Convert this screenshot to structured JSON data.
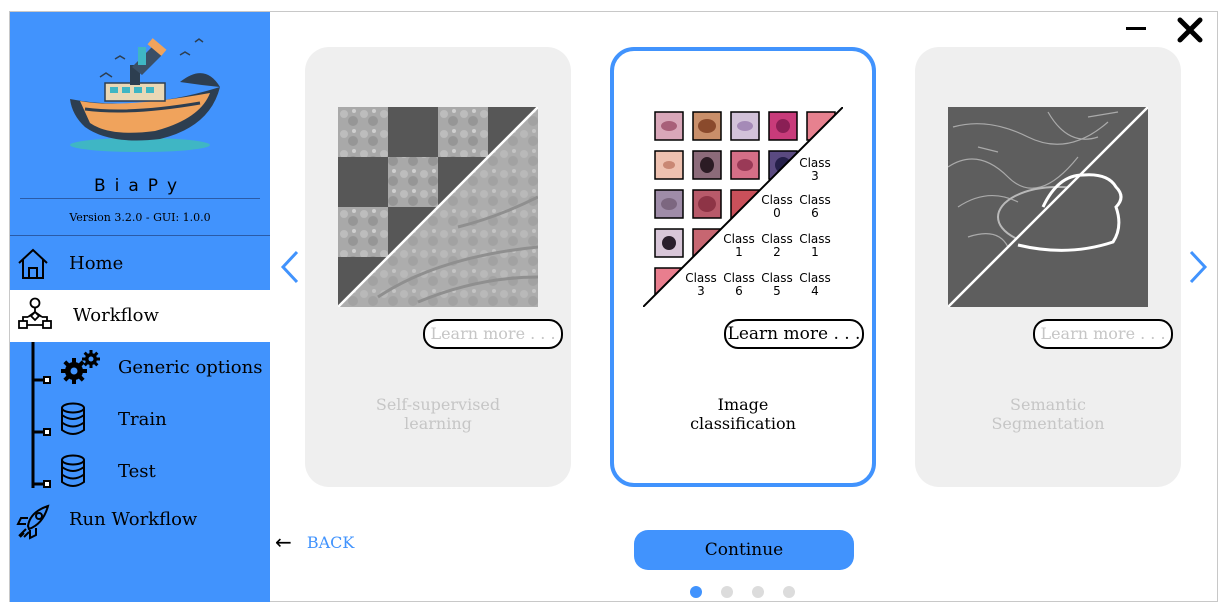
{
  "sidebar": {
    "app_name": "BiaPy",
    "version": "Version 3.2.0 - GUI: 1.0.0",
    "items": [
      {
        "label": "Home",
        "icon": "home-icon"
      },
      {
        "label": "Workflow",
        "icon": "workflow-icon",
        "selected": true
      },
      {
        "label": "Generic options",
        "icon": "gears-icon"
      },
      {
        "label": "Train",
        "icon": "database-icon"
      },
      {
        "label": "Test",
        "icon": "database-icon"
      },
      {
        "label": "Run Workflow",
        "icon": "rocket-icon"
      }
    ]
  },
  "window": {
    "minimize_icon": "minimize-icon",
    "close_icon": "close-icon"
  },
  "cards": [
    {
      "title_line1": "Self-supervised",
      "title_line2": "learning",
      "learn_more": "Learn more . . .",
      "active": false
    },
    {
      "title_line1": "Image",
      "title_line2": "classification",
      "learn_more": "Learn more . . .",
      "active": true,
      "class_labels": [
        {
          "text": "Class",
          "num": "3"
        },
        {
          "text": "Class",
          "num": "0"
        },
        {
          "text": "Class",
          "num": "6"
        },
        {
          "text": "Class",
          "num": "1"
        },
        {
          "text": "Class",
          "num": "2"
        },
        {
          "text": "Class",
          "num": "1"
        },
        {
          "text": "Class",
          "num": "3"
        },
        {
          "text": "Class",
          "num": "6"
        },
        {
          "text": "Class",
          "num": "5"
        },
        {
          "text": "Class",
          "num": "4"
        }
      ]
    },
    {
      "title_line1": "Semantic",
      "title_line2": "Segmentation",
      "learn_more": "Learn more . . .",
      "active": false
    }
  ],
  "nav": {
    "back_arrow": "←",
    "back_label": "BACK",
    "continue_label": "Continue"
  },
  "pagination": {
    "total": 4,
    "current": 1
  },
  "colors": {
    "accent": "#4193fd",
    "card_bg": "#efefef",
    "inactive_text": "#c6c6c6"
  }
}
